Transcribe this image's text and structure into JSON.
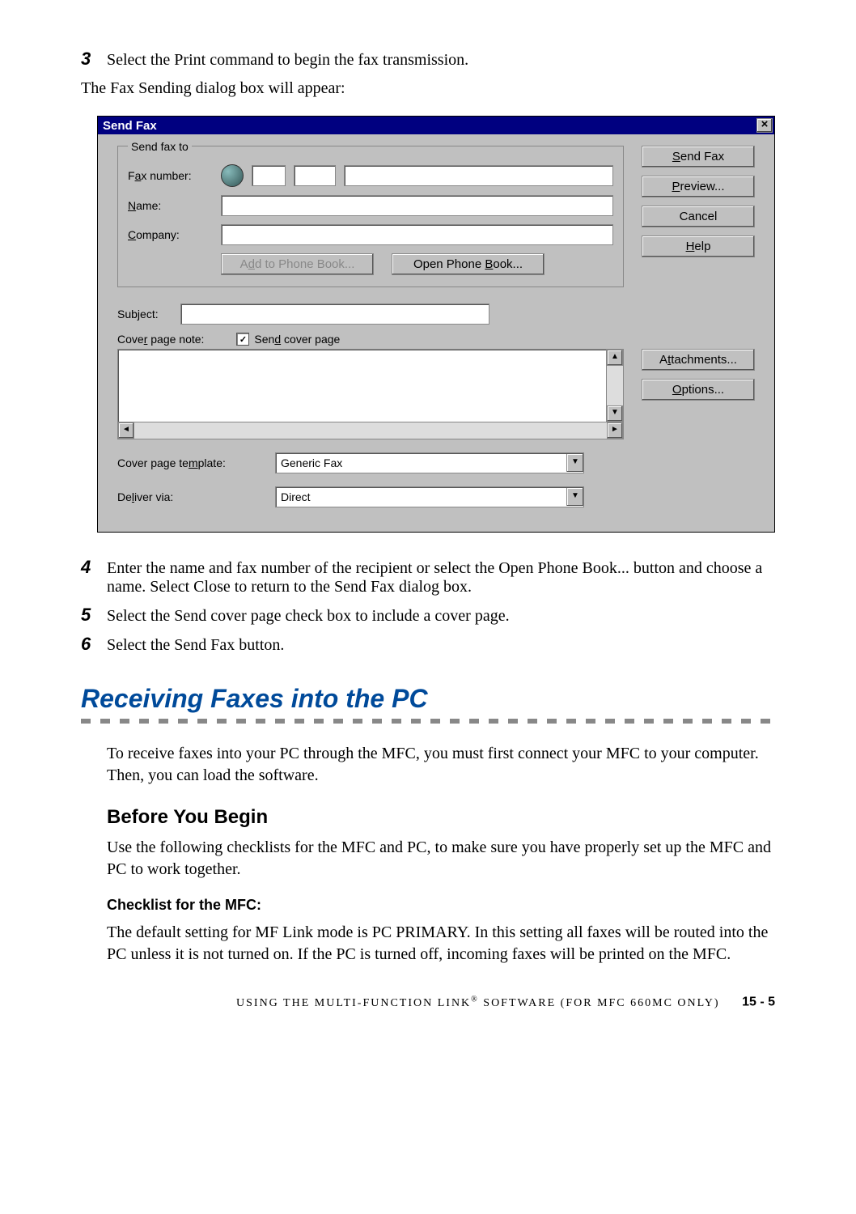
{
  "step3": {
    "num": "3",
    "text": "Select the Print command to begin the fax transmission.",
    "caption": "The Fax Sending dialog box will appear:"
  },
  "dialog": {
    "title": "Send Fax",
    "fieldset_legend": "Send fax to",
    "fax_number_label_pre": "F",
    "fax_number_label_u": "a",
    "fax_number_label_post": "x number:",
    "name_label_u": "N",
    "name_label_post": "ame:",
    "company_label_u": "C",
    "company_label_post": "ompany:",
    "send_fax_btn_u": "S",
    "send_fax_btn_post": "end Fax",
    "preview_btn_u": "P",
    "preview_btn_post": "review...",
    "cancel_btn": "Cancel",
    "help_btn_u": "H",
    "help_btn_post": "elp",
    "add_phone_btn_pre": "A",
    "add_phone_btn_u": "d",
    "add_phone_btn_post": "d to Phone Book...",
    "open_phone_btn_pre": "Open Phone ",
    "open_phone_btn_u": "B",
    "open_phone_btn_post": "ook...",
    "subject_label_pre": "Sub",
    "subject_label_u": "j",
    "subject_label_post": "ect:",
    "cover_note_label_pre": "Cove",
    "cover_note_label_u": "r",
    "cover_note_label_post": " page note:",
    "send_cover_chk_pre": "Sen",
    "send_cover_chk_u": "d",
    "send_cover_chk_post": " cover page",
    "attachments_btn_pre": "A",
    "attachments_btn_u": "t",
    "attachments_btn_post": "tachments...",
    "options_btn_u": "O",
    "options_btn_post": "ptions...",
    "cover_template_label_pre": "Cover page te",
    "cover_template_label_u": "m",
    "cover_template_label_post": "plate:",
    "cover_template_value": "Generic Fax",
    "deliver_via_label_pre": "De",
    "deliver_via_label_u": "l",
    "deliver_via_label_post": "iver via:",
    "deliver_via_value": "Direct"
  },
  "step4": {
    "num": "4",
    "text": "Enter the name and fax number of the recipient or select the Open Phone Book... button and choose a name.  Select Close to return to the Send Fax dialog box."
  },
  "step5": {
    "num": "5",
    "text": "Select the Send cover page check box to include a cover page."
  },
  "step6": {
    "num": "6",
    "text": "Select the Send Fax button."
  },
  "section_title": "Receiving Faxes into the PC",
  "section_para": "To receive faxes into your PC through the MFC, you must first connect your MFC to your computer. Then, you can load the software.",
  "before_heading": "Before You Begin",
  "before_para": "Use the following checklists for the MFC and PC, to make sure you have properly set up the MFC and PC to work together.",
  "checklist_heading": "Checklist for the MFC:",
  "checklist_para": "The default setting for MF Link mode is PC PRIMARY. In this setting all faxes will be routed into the PC unless it is not turned on. If the PC is turned off, incoming faxes will be printed on the MFC.",
  "footer_text_1": "USING THE MULTI-FUNCTION LINK",
  "footer_text_2": " SOFTWARE (FOR MFC 660MC ONLY)",
  "page_num": "15 - 5"
}
